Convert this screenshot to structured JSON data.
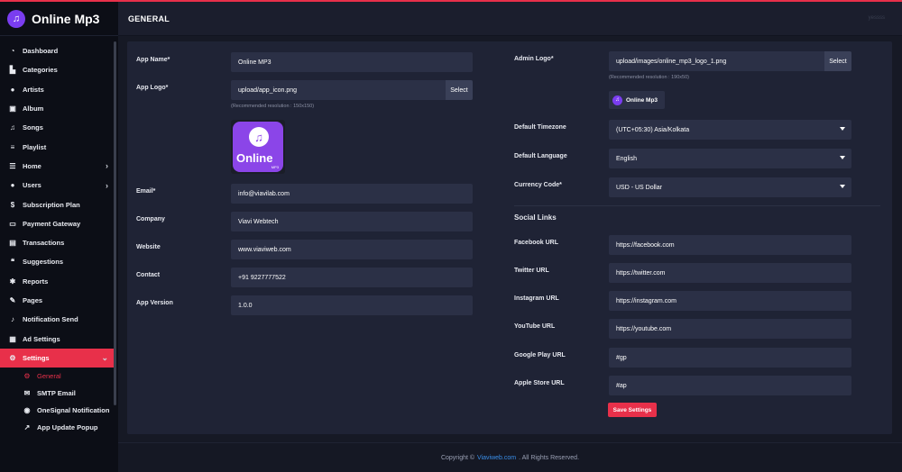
{
  "app": {
    "name": "Online Mp3",
    "logo_icon": "music-note-icon"
  },
  "header": {
    "title": "GENERAL",
    "user": "yessss"
  },
  "sidebar": {
    "items": [
      {
        "label": "Dashboard",
        "icon": "dashboard-icon"
      },
      {
        "label": "Categories",
        "icon": "categories-icon"
      },
      {
        "label": "Artists",
        "icon": "users-icon"
      },
      {
        "label": "Album",
        "icon": "album-icon"
      },
      {
        "label": "Songs",
        "icon": "music-note-icon"
      },
      {
        "label": "Playlist",
        "icon": "list-icon"
      },
      {
        "label": "Home",
        "icon": "sliders-icon"
      },
      {
        "label": "Users",
        "icon": "users-icon"
      },
      {
        "label": "Subscription Plan",
        "icon": "dollar-icon"
      },
      {
        "label": "Payment Gateway",
        "icon": "credit-card-icon"
      },
      {
        "label": "Transactions",
        "icon": "table-icon"
      },
      {
        "label": "Suggestions",
        "icon": "comments-icon"
      },
      {
        "label": "Reports",
        "icon": "bug-icon"
      },
      {
        "label": "Pages",
        "icon": "edit-icon"
      },
      {
        "label": "Notification Send",
        "icon": "bell-icon"
      },
      {
        "label": "Ad Settings",
        "icon": "ad-icon"
      },
      {
        "label": "Settings",
        "icon": "gear-icon"
      }
    ],
    "sub_items": [
      {
        "label": "General",
        "icon": "gear-icon"
      },
      {
        "label": "SMTP Email",
        "icon": "envelope-icon"
      },
      {
        "label": "OneSignal Notification",
        "icon": "pin-icon"
      },
      {
        "label": "App Update Popup",
        "icon": "external-link-icon"
      }
    ]
  },
  "form": {
    "app_name": {
      "label": "App Name*",
      "value": "Online MP3"
    },
    "app_logo": {
      "label": "App Logo*",
      "value": "upload/app_icon.png",
      "button": "Select",
      "hint": "(Recommended resolution : 150x150)"
    },
    "app_icon_preview": {
      "text": "Online",
      "small": "MP3"
    },
    "email": {
      "label": "Email*",
      "value": "info@viavilab.com"
    },
    "company": {
      "label": "Company",
      "value": "Viavi Webtech"
    },
    "website": {
      "label": "Website",
      "value": "www.viaviweb.com"
    },
    "contact": {
      "label": "Contact",
      "value": "+91 9227777522"
    },
    "app_version": {
      "label": "App Version",
      "value": "1.0.0"
    },
    "admin_logo": {
      "label": "Admin Logo*",
      "value": "upload/images/online_mp3_logo_1.png",
      "button": "Select",
      "hint": "(Recommended resolution : 190x50)",
      "preview_text": "Online Mp3"
    },
    "timezone": {
      "label": "Default Timezone",
      "value": "(UTC+05:30) Asia/Kolkata"
    },
    "language": {
      "label": "Default Language",
      "value": "English"
    },
    "currency": {
      "label": "Currency Code*",
      "value": "USD - US Dollar"
    },
    "social_title": "Social Links",
    "facebook": {
      "label": "Facebook URL",
      "value": "https://facebook.com"
    },
    "twitter": {
      "label": "Twitter URL",
      "value": "https://twitter.com"
    },
    "instagram": {
      "label": "Instagram URL",
      "value": "https://instagram.com"
    },
    "youtube": {
      "label": "YouTube URL",
      "value": "https://youtube.com"
    },
    "google_play": {
      "label": "Google Play URL",
      "value": "#gp"
    },
    "apple_store": {
      "label": "Apple Store URL",
      "value": "#ap"
    },
    "save": "Save Settings"
  },
  "footer": {
    "prefix": "Copyright ©",
    "link": "Viaviweb.com",
    "suffix": ". All Rights Reserved."
  },
  "colors": {
    "accent": "#e8304a",
    "brand": "#7a3df0",
    "link": "#3a8ee8"
  }
}
